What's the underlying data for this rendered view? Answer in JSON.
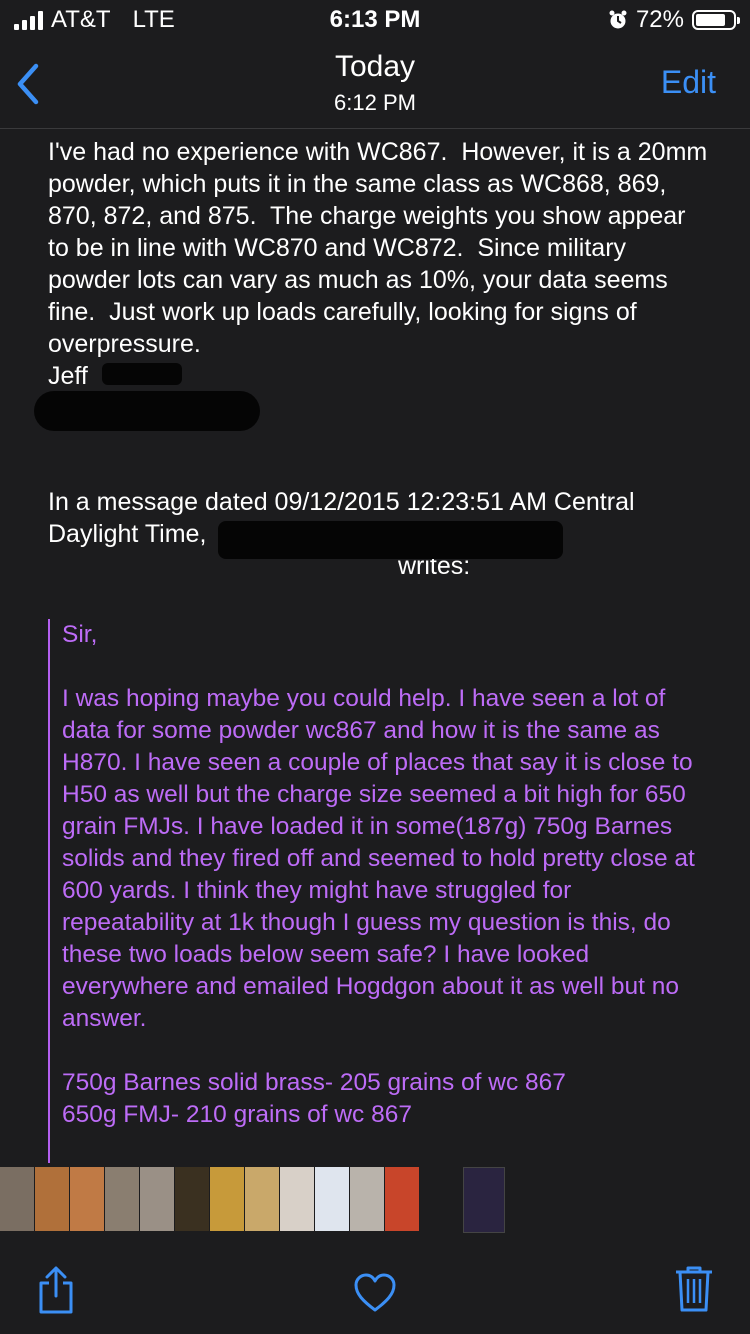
{
  "status_bar": {
    "carrier": "AT&T",
    "network": "LTE",
    "time": "6:13 PM",
    "battery": "72%",
    "battery_level": 0.72,
    "icons": [
      "signal-bars-icon",
      "alarm-icon",
      "battery-icon"
    ]
  },
  "nav": {
    "back_icon": "chevron-left-icon",
    "title": "Today",
    "subtitle": "6:12 PM",
    "edit_label": "Edit",
    "accent_color": "#3b8ff5"
  },
  "message": {
    "body": "I've had no experience with WC867.  However, it is a 20mm powder, which puts it in the same class as WC868, 869, 870, 872, and 875.  The charge weights you show appear to be in line with WC870 and WC872.  Since military powder lots can vary as much as 10%, your data seems fine.  Just work up loads carefully, looking for signs of overpressure.",
    "signature": "Jeff",
    "quoted_header_prefix": "In a message dated 09/12/2015 12:23:51 AM Central Daylight Time,",
    "quoted_header_suffix": "writes:",
    "quote_color": "#bd6cf7",
    "quote": {
      "greeting": "Sir,",
      "paragraph": "I was hoping maybe you could help. I have seen a lot of data for some powder wc867 and how it is the same as H870. I have seen a couple of places that say it is close to H50 as well but the charge size seemed a bit high for 650 grain FMJs. I have loaded it in some(187g) 750g Barnes solids and they fired off and seemed to hold pretty close at 600 yards. I think they might have struggled for repeatability at 1k though I guess my question is this, do these two loads below seem safe? I have looked everywhere and emailed Hogdgon about it as well but no answer.",
      "load_1": "750g Barnes solid brass- 205 grains of wc 867",
      "load_2": "650g FMJ- 210 grains of wc 867"
    }
  },
  "thumbnails": [
    {
      "color": "#7a6e62"
    },
    {
      "color": "#b0703a"
    },
    {
      "color": "#c07a45"
    },
    {
      "color": "#8a7e70"
    },
    {
      "color": "#9a9086"
    },
    {
      "color": "#3a3020"
    },
    {
      "color": "#c79a3a"
    },
    {
      "color": "#c9a86a"
    },
    {
      "color": "#d8d0c8"
    },
    {
      "color": "#dfe5ee"
    },
    {
      "color": "#b9b3ab"
    },
    {
      "color": "#c8452a"
    },
    {
      "color": "#1c1c1e"
    },
    {
      "color": "#2a2440"
    }
  ],
  "toolbar": {
    "share_icon": "share-icon",
    "like_icon": "heart-icon",
    "delete_icon": "trash-icon"
  }
}
